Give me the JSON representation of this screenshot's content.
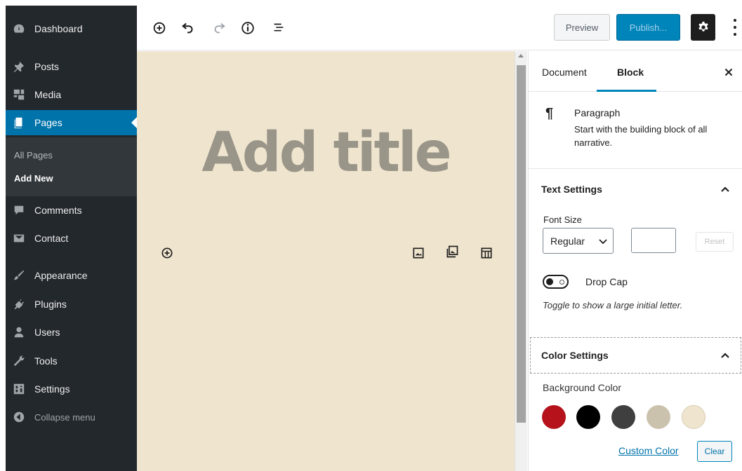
{
  "sidebar": {
    "items": [
      {
        "label": "Dashboard",
        "icon": "dashboard-icon"
      },
      {
        "label": "Posts",
        "icon": "pin-icon"
      },
      {
        "label": "Media",
        "icon": "media-icon"
      },
      {
        "label": "Pages",
        "icon": "page-icon",
        "active": true
      },
      {
        "label": "Comments",
        "icon": "comment-icon"
      },
      {
        "label": "Contact",
        "icon": "mail-icon"
      },
      {
        "label": "Appearance",
        "icon": "paintbrush-icon"
      },
      {
        "label": "Plugins",
        "icon": "plugin-icon"
      },
      {
        "label": "Users",
        "icon": "user-icon"
      },
      {
        "label": "Tools",
        "icon": "wrench-icon"
      },
      {
        "label": "Settings",
        "icon": "settings-icon"
      }
    ],
    "submenu": [
      "All Pages",
      "Add New"
    ],
    "collapse_label": "Collapse menu"
  },
  "toolbar": {
    "icons": [
      "add-block-icon",
      "undo-icon",
      "redo-icon",
      "info-icon",
      "outline-icon"
    ],
    "preview_label": "Preview",
    "publish_label": "Publish...",
    "settings_icon": "gear-icon",
    "more_icon": "more-vertical-icon"
  },
  "editor": {
    "title_placeholder": "Add title",
    "background_color": "#efe4ce",
    "inserter_icons": [
      "add-block-icon",
      "image-icon",
      "gallery-icon",
      "table-icon"
    ]
  },
  "panel": {
    "tabs": [
      "Document",
      "Block"
    ],
    "active_tab": "Block",
    "block": {
      "icon": "¶",
      "title": "Paragraph",
      "description": "Start with the building block of all narrative."
    },
    "text_settings": {
      "heading": "Text Settings",
      "font_size_label": "Font Size",
      "font_size_value": "Regular",
      "custom_size_value": "",
      "reset_label": "Reset",
      "drop_cap_label": "Drop Cap",
      "drop_cap_on": false,
      "drop_cap_help": "Toggle to show a large initial letter."
    },
    "color_settings": {
      "heading": "Color Settings",
      "background_label": "Background Color",
      "swatches": [
        "#b5121b",
        "#000000",
        "#3f3f3f",
        "#cbc2ae",
        "#efe4ce"
      ],
      "custom_color_label": "Custom Color",
      "clear_label": "Clear"
    }
  }
}
